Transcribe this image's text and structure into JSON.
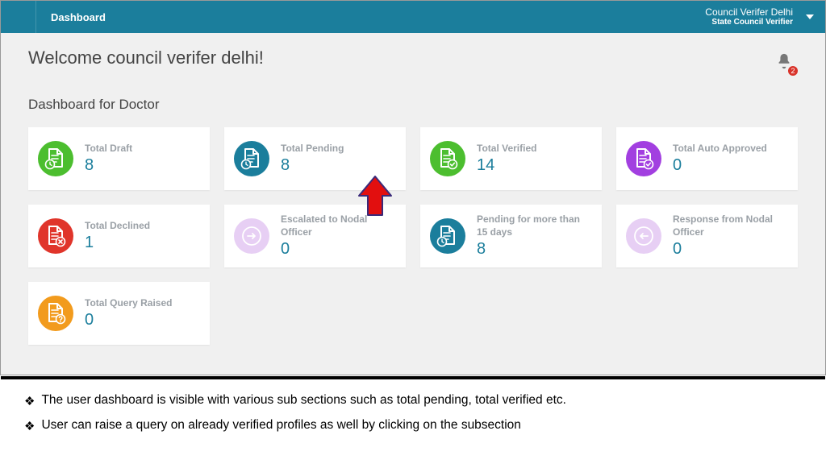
{
  "topbar": {
    "title": "Dashboard",
    "user_line1": "Council Verifer Delhi",
    "user_line2": "State Council Verifier"
  },
  "welcome": "Welcome council verifer delhi!",
  "notifications_count": "2",
  "section_title": "Dashboard for Doctor",
  "colors": {
    "green": "#4cbe2f",
    "blue": "#1b7e9c",
    "purple": "#a23fe0",
    "red": "#e0352b",
    "lilac": "#e7cff4",
    "orange": "#f29b1d",
    "arrow": "#e20f0f"
  },
  "cards": [
    {
      "label": "Total Draft",
      "value": "8",
      "icon": "doc-clock",
      "color": "green"
    },
    {
      "label": "Total Pending",
      "value": "8",
      "icon": "doc-clock",
      "color": "blue"
    },
    {
      "label": "Total Verified",
      "value": "14",
      "icon": "doc-check",
      "color": "green"
    },
    {
      "label": "Total Auto Approved",
      "value": "0",
      "icon": "doc-check",
      "color": "purple"
    },
    {
      "label": "Total Declined",
      "value": "1",
      "icon": "doc-cross",
      "color": "red"
    },
    {
      "label": "Escalated to Nodal Officer",
      "value": "0",
      "icon": "doc-forward",
      "color": "lilac"
    },
    {
      "label": "Pending for more than 15 days",
      "value": "8",
      "icon": "doc-clock",
      "color": "blue"
    },
    {
      "label": "Response from Nodal Officer",
      "value": "0",
      "icon": "doc-back",
      "color": "lilac"
    },
    {
      "label": "Total Query Raised",
      "value": "0",
      "icon": "doc-question",
      "color": "orange"
    }
  ],
  "notes": [
    "The user dashboard is visible with various sub sections such as total pending, total verified etc.",
    "User can raise a query on already verified profiles as well by clicking on the subsection"
  ]
}
